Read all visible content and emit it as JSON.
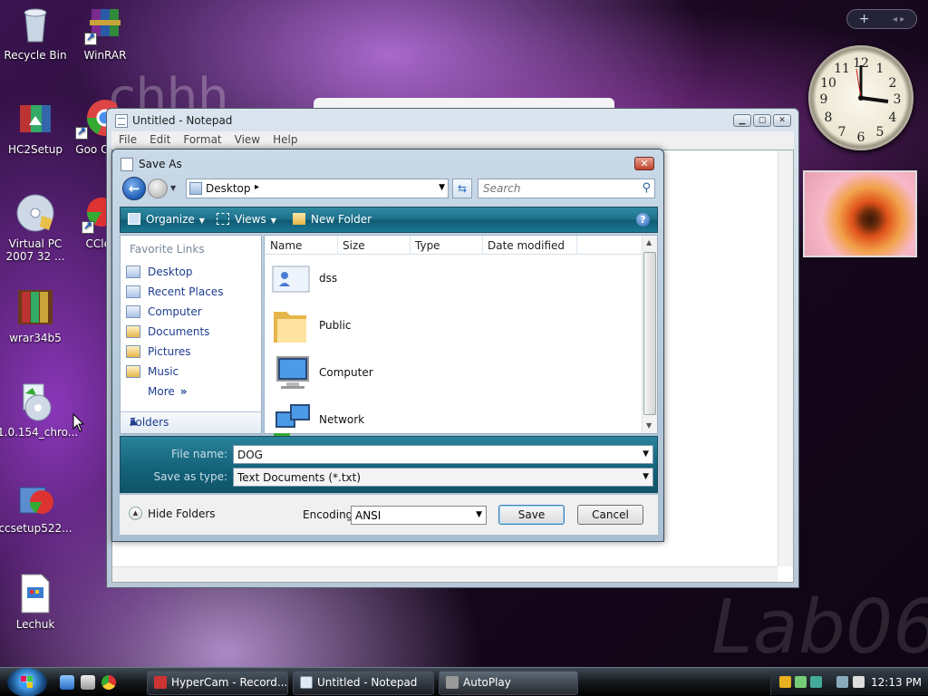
{
  "desktop": {
    "icons": [
      {
        "label": "Recycle Bin"
      },
      {
        "label": "WinRAR"
      },
      {
        "label": "HC2Setup"
      },
      {
        "label": "Goo Chr"
      },
      {
        "label": "Virtual PC 2007 32 ..."
      },
      {
        "label": "CCle"
      },
      {
        "label": "wrar34b5"
      },
      {
        "label": "1.0.154_chro..."
      },
      {
        "label": "ccsetup522..."
      },
      {
        "label": "Lechuk"
      }
    ],
    "watermark": "Lab06",
    "ghost_text": "chhh"
  },
  "sidebar": {
    "add_button": "+",
    "nav_arrows": "◂ ▸"
  },
  "notepad": {
    "title": "Untitled - Notepad",
    "menu": [
      "File",
      "Edit",
      "Format",
      "View",
      "Help"
    ]
  },
  "dialog": {
    "title": "Save As",
    "close": "✕",
    "address": "Desktop",
    "search_placeholder": "Search",
    "toolbar": {
      "organize": "Organize",
      "views": "Views",
      "new_folder": "New Folder",
      "help": "?"
    },
    "favorite_links_header": "Favorite Links",
    "favorite_links": [
      "Desktop",
      "Recent Places",
      "Computer",
      "Documents",
      "Pictures",
      "Music"
    ],
    "more": "More",
    "folders_label": "Folders",
    "columns": [
      "Name",
      "Size",
      "Type",
      "Date modified"
    ],
    "files": [
      {
        "name": "dss"
      },
      {
        "name": "Public"
      },
      {
        "name": "Computer"
      },
      {
        "name": "Network"
      }
    ],
    "file_name_label": "File name:",
    "file_name_value": "DOG",
    "save_type_label": "Save as type:",
    "save_type_value": "Text Documents (*.txt)",
    "hide_folders": "Hide Folders",
    "encoding_label": "Encoding:",
    "encoding_value": "ANSI",
    "save_button": "Save",
    "cancel_button": "Cancel"
  },
  "taskbar": {
    "tasks": [
      {
        "label": "HyperCam - Record..."
      },
      {
        "label": "Untitled - Notepad"
      },
      {
        "label": "AutoPlay"
      }
    ],
    "clock": "12:13 PM"
  }
}
